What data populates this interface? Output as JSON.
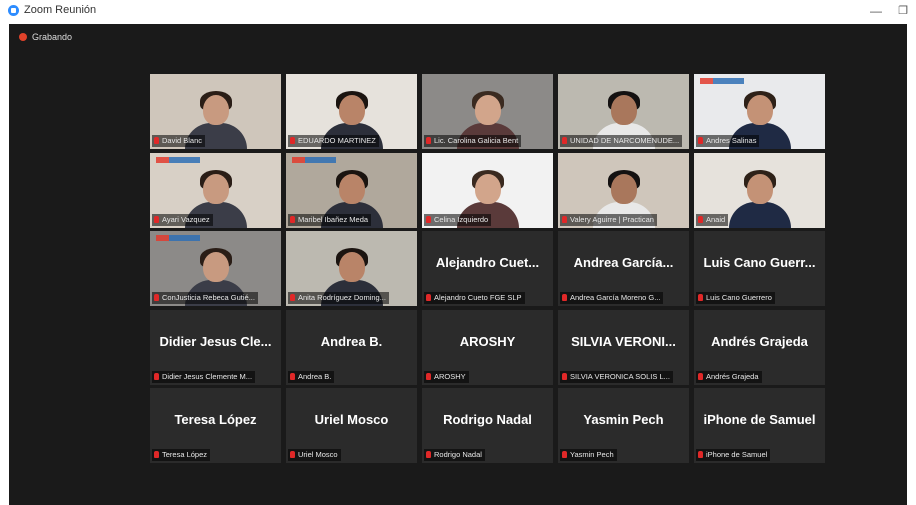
{
  "window": {
    "title": "Zoom Reunión",
    "minimize_glyph": "—",
    "restore_glyph": "❐"
  },
  "recording": {
    "label": "Grabando"
  },
  "participants": [
    {
      "tag": "David Blanc",
      "big": "",
      "video": true
    },
    {
      "tag": "EDUARDO MARTINEZ",
      "big": "",
      "video": true
    },
    {
      "tag": "Lic. Carolina Galicia Bent",
      "big": "",
      "video": true
    },
    {
      "tag": "UNIDAD DE NARCOMENUDE...",
      "big": "",
      "video": true,
      "active": true
    },
    {
      "tag": "Andres Salinas",
      "big": "",
      "video": true
    },
    {
      "tag": "Ayari Vazquez",
      "big": "",
      "video": true
    },
    {
      "tag": "Maribel Ibañez Meda",
      "big": "",
      "video": true
    },
    {
      "tag": "Celina Izquierdo",
      "big": "",
      "video": true
    },
    {
      "tag": "Valery Aguirre | Practican",
      "big": "",
      "video": true
    },
    {
      "tag": "Anaid",
      "big": "",
      "video": true
    },
    {
      "tag": "ConJusticia Rebeca Gutié...",
      "big": "",
      "video": true
    },
    {
      "tag": "Anita Rodríguez Doming...",
      "big": "",
      "video": true
    },
    {
      "tag": "Alejandro Cueto FGE SLP",
      "big": "Alejandro Cuet...",
      "video": false
    },
    {
      "tag": "Andrea García Moreno G...",
      "big": "Andrea García...",
      "video": false
    },
    {
      "tag": "Luis Cano Guerrero",
      "big": "Luis Cano Guerr...",
      "video": false
    },
    {
      "tag": "Didier Jesus Clemente M...",
      "big": "Didier Jesus Cle...",
      "video": false
    },
    {
      "tag": "Andrea B.",
      "big": "Andrea B.",
      "video": false
    },
    {
      "tag": "AROSHY",
      "big": "AROSHY",
      "video": false
    },
    {
      "tag": "SILVIA VERONICA SOLIS L...",
      "big": "SILVIA VERONI...",
      "video": false
    },
    {
      "tag": "Andrés Grajeda",
      "big": "Andrés Grajeda",
      "video": false
    },
    {
      "tag": "Teresa López",
      "big": "Teresa López",
      "video": false
    },
    {
      "tag": "Uriel Mosco",
      "big": "Uriel Mosco",
      "video": false
    },
    {
      "tag": "Rodrigo Nadal",
      "big": "Rodrigo Nadal",
      "video": false
    },
    {
      "tag": "Yasmin Pech",
      "big": "Yasmin Pech",
      "video": false
    },
    {
      "tag": "iPhone de Samuel",
      "big": "iPhone de Samuel",
      "video": false
    }
  ],
  "colors": {
    "meeting_bg": "#1a1a1a",
    "tile_bg": "#2b2b2b",
    "active_speaker": "#a8d63b",
    "muted_icon": "#e02828",
    "recording_dot": "#e0422a"
  }
}
